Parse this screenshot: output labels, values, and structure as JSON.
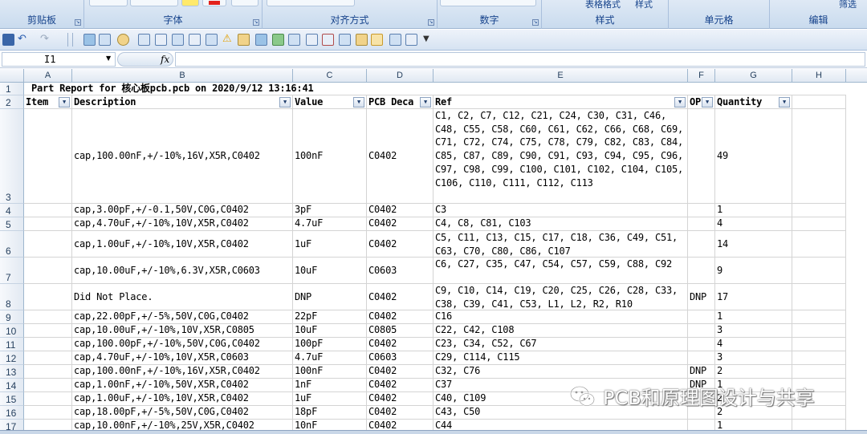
{
  "ribbon": {
    "groups": [
      {
        "label": "剪贴板"
      },
      {
        "label": "字体"
      },
      {
        "label": "对齐方式"
      },
      {
        "label": "数字"
      },
      {
        "label": "样式"
      },
      {
        "label": "单元格"
      },
      {
        "label": "编辑"
      }
    ],
    "table_format_label": "表格格式",
    "cell_style_label": "样式",
    "filter_label": "筛选"
  },
  "formula_bar": {
    "name_box": "I1",
    "fx": "fx",
    "formula": ""
  },
  "columns": [
    "A",
    "B",
    "C",
    "D",
    "E",
    "F",
    "G",
    "H"
  ],
  "title_row": {
    "row_number": "1",
    "text": "Part Report for 核心板pcb.pcb on 2020/9/12 13:16:41"
  },
  "header_row": {
    "row_number": "2",
    "cells": [
      "Item",
      "Description",
      "Value",
      "PCB Deca",
      "Ref",
      "OP",
      "Quantity"
    ]
  },
  "rows": [
    {
      "n": "3",
      "description": "cap,100.00nF,+/-10%,16V,X5R,C0402",
      "value": "100nF",
      "pcb": "C0402",
      "ref": "C1, C2, C7, C12, C21, C24, C30, C31, C46, C48, C55, C58, C60, C61, C62, C66, C68, C69, C71, C72, C74, C75, C78, C79, C82, C83, C84, C85, C87, C89, C90, C91, C93, C94, C95, C96, C97, C98, C99, C100, C101, C102, C104, C105, C106, C110, C111, C112, C113",
      "op": "",
      "qty": "49"
    },
    {
      "n": "4",
      "description": "cap,3.00pF,+/-0.1,50V,C0G,C0402",
      "value": "3pF",
      "pcb": "C0402",
      "ref": "C3",
      "op": "",
      "qty": "1"
    },
    {
      "n": "5",
      "description": "cap,4.70uF,+/-10%,10V,X5R,C0402",
      "value": "4.7uF",
      "pcb": "C0402",
      "ref": "C4, C8, C81, C103",
      "op": "",
      "qty": "4"
    },
    {
      "n": "6",
      "description": "cap,1.00uF,+/-10%,10V,X5R,C0402",
      "value": "1uF",
      "pcb": "C0402",
      "ref": "C5, C11, C13, C15, C17, C18, C36, C49, C51, C63, C70, C80, C86, C107",
      "op": "",
      "qty": "14"
    },
    {
      "n": "7",
      "description": "cap,10.00uF,+/-10%,6.3V,X5R,C0603",
      "value": "10uF",
      "pcb": "C0603",
      "ref": "C6, C27, C35, C47, C54, C57, C59, C88, C92",
      "op": "",
      "qty": "9"
    },
    {
      "n": "8",
      "description": "Did Not Place.",
      "value": "DNP",
      "pcb": "C0402",
      "ref": "C9, C10, C14, C19, C20, C25, C26, C28, C33, C38, C39, C41, C53, L1, L2, R2, R10",
      "op": "DNP",
      "qty": "17"
    },
    {
      "n": "9",
      "description": "cap,22.00pF,+/-5%,50V,C0G,C0402",
      "value": "22pF",
      "pcb": "C0402",
      "ref": "C16",
      "op": "",
      "qty": "1"
    },
    {
      "n": "10",
      "description": "cap,10.00uF,+/-10%,10V,X5R,C0805",
      "value": "10uF",
      "pcb": "C0805",
      "ref": "C22, C42, C108",
      "op": "",
      "qty": "3"
    },
    {
      "n": "11",
      "description": "cap,100.00pF,+/-10%,50V,C0G,C0402",
      "value": "100pF",
      "pcb": "C0402",
      "ref": "C23, C34, C52, C67",
      "op": "",
      "qty": "4"
    },
    {
      "n": "12",
      "description": "cap,4.70uF,+/-10%,10V,X5R,C0603",
      "value": "4.7uF",
      "pcb": "C0603",
      "ref": "C29, C114, C115",
      "op": "",
      "qty": "3"
    },
    {
      "n": "13",
      "description": "cap,100.00nF,+/-10%,16V,X5R,C0402",
      "value": "100nF",
      "pcb": "C0402",
      "ref": "C32, C76",
      "op": "DNP",
      "qty": "2"
    },
    {
      "n": "14",
      "description": "cap,1.00nF,+/-10%,50V,X5R,C0402",
      "value": "1nF",
      "pcb": "C0402",
      "ref": "C37",
      "op": "DNP",
      "qty": "1"
    },
    {
      "n": "15",
      "description": "cap,1.00uF,+/-10%,10V,X5R,C0402",
      "value": "1uF",
      "pcb": "C0402",
      "ref": "C40, C109",
      "op": "",
      "qty": "2"
    },
    {
      "n": "16",
      "description": "cap,18.00pF,+/-5%,50V,C0G,C0402",
      "value": "18pF",
      "pcb": "C0402",
      "ref": "C43, C50",
      "op": "",
      "qty": "2"
    },
    {
      "n": "17",
      "description": "cap,10.00nF,+/-10%,25V,X5R,C0402",
      "value": "10nF",
      "pcb": "C0402",
      "ref": "C44",
      "op": "",
      "qty": "1"
    }
  ],
  "watermark": {
    "text": "PCB和原理图设计与共享",
    "icon": "wechat-icon"
  },
  "colors": {
    "ribbon_bg": "#c9dbee",
    "ribbon_label": "#15428b",
    "grid_line": "#d4d4d4",
    "header_bg": "#e0e8f2"
  }
}
